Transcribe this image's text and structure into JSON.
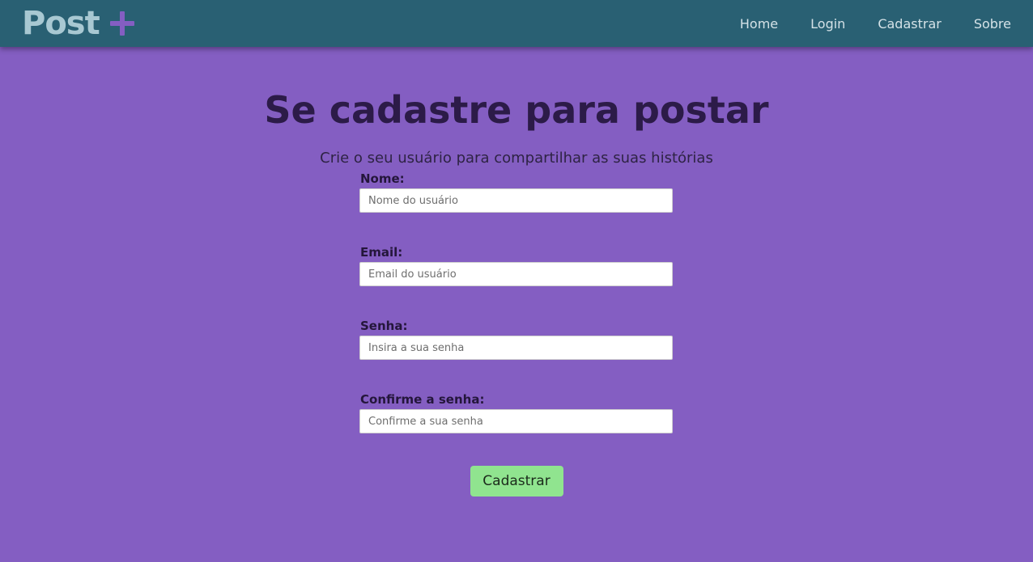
{
  "colors": {
    "background": "#845ec2",
    "navbar": "#296073",
    "logo_text": "#a8c8d2",
    "logo_plus": "#845ec2",
    "title": "#2c1b48",
    "button": "#90e48f"
  },
  "header": {
    "logo": {
      "text": "Post",
      "icon": "plus-icon"
    },
    "nav": [
      {
        "label": "Home"
      },
      {
        "label": "Login"
      },
      {
        "label": "Cadastrar"
      },
      {
        "label": "Sobre"
      }
    ]
  },
  "main": {
    "title": "Se cadastre para postar",
    "subtitle": "Crie o seu usuário para compartilhar as suas histórias",
    "form": {
      "fields": [
        {
          "label": "Nome:",
          "placeholder": "Nome do usuário",
          "value": ""
        },
        {
          "label": "Email:",
          "placeholder": "Email do usuário",
          "value": ""
        },
        {
          "label": "Senha:",
          "placeholder": "Insira a sua senha",
          "value": ""
        },
        {
          "label": "Confirme a senha:",
          "placeholder": "Confirme a sua senha",
          "value": ""
        }
      ],
      "submit_label": "Cadastrar"
    }
  }
}
